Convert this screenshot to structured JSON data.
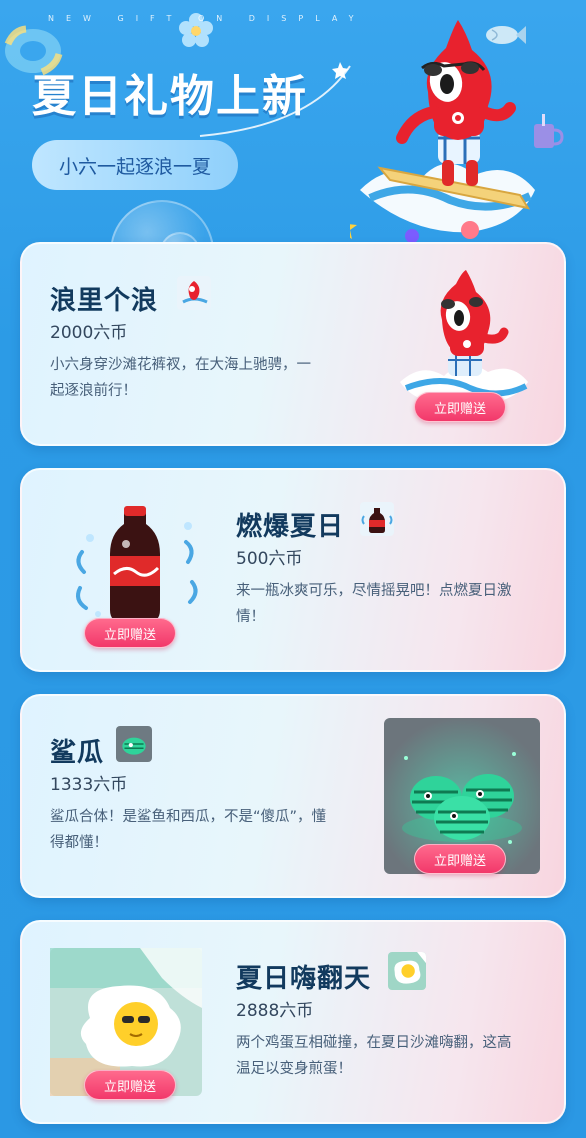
{
  "header": {
    "tagline": "NEW GIFT ON DISPLAY",
    "title": "夏日礼物上新",
    "subtitle": "小六一起逐浪一夏"
  },
  "gifts": [
    {
      "name": "浪里个浪",
      "price": "2000六币",
      "desc": "小六身穿沙滩花裤衩，在大海上驰骋，一起逐浪前行！",
      "button": "立即赠送",
      "icon": "surfing-mascot-icon"
    },
    {
      "name": "燃爆夏日",
      "price": "500六币",
      "desc": "来一瓶冰爽可乐，尽情摇晃吧！点燃夏日激情！",
      "button": "立即赠送",
      "icon": "cola-bottle-icon"
    },
    {
      "name": "鲨瓜",
      "price": "1333六币",
      "desc": "鲨瓜合体！是鲨鱼和西瓜，不是“傻瓜”，懂得都懂！",
      "button": "立即赠送",
      "icon": "shark-melon-icon"
    },
    {
      "name": "夏日嗨翻天",
      "price": "2888六币",
      "desc": "两个鸡蛋互相碰撞，在夏日沙滩嗨翻，这高温足以变身煎蛋！",
      "button": "立即赠送",
      "icon": "fried-egg-icon"
    }
  ],
  "colors": {
    "background": "#2c9be6",
    "button": "#f2386a",
    "title_text": "#123a5e"
  }
}
